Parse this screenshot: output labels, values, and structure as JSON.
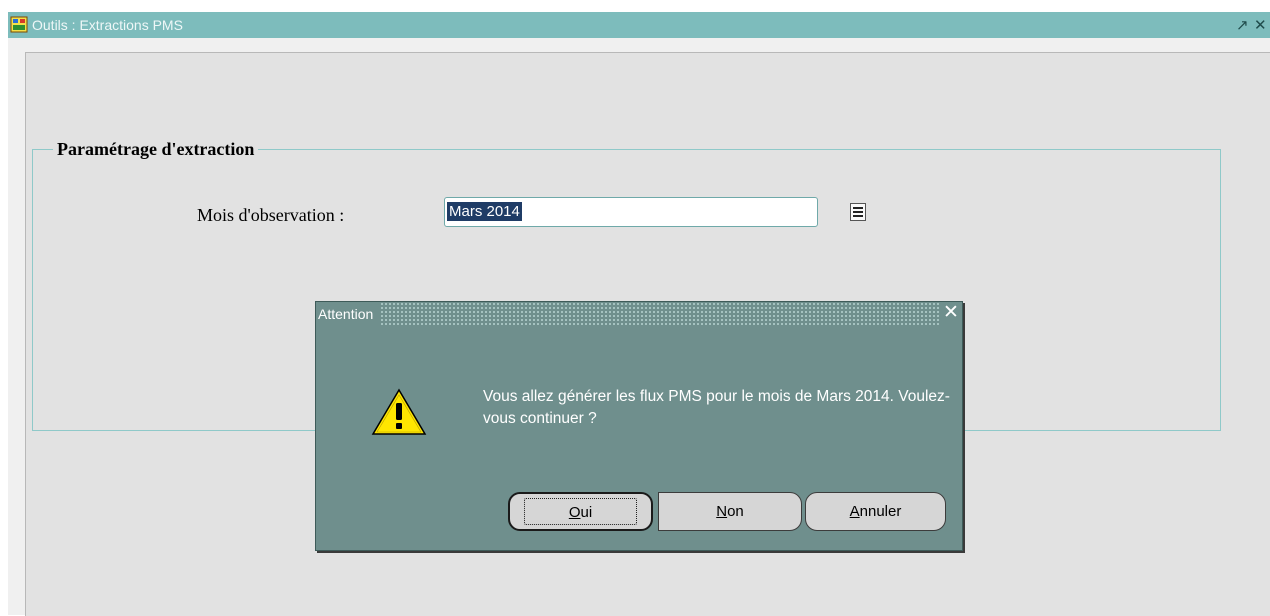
{
  "window": {
    "title": "Outils : Extractions PMS",
    "minimize_glyph": "↗",
    "close_glyph": "✕"
  },
  "form": {
    "frame_title": "Paramétrage d'extraction",
    "month_label": "Mois d'observation :",
    "month_value": "Mars 2014",
    "list_button_icon": "list-icon"
  },
  "dialog": {
    "title": "Attention",
    "close_glyph": "✕",
    "icon": "warning-icon",
    "message": "Vous allez générer les flux PMS pour le mois de Mars 2014. Voulez-vous continuer ?",
    "buttons": {
      "yes_mnemonic": "O",
      "yes_rest": "ui",
      "no_mnemonic": "N",
      "no_rest": "on",
      "cancel_mnemonic": "A",
      "cancel_rest": "nnuler"
    }
  },
  "colors": {
    "titlebar": "#7dbcbc",
    "dialog_bg": "#6f8f8d",
    "canvas_bg": "#e2e2e2",
    "selection": "#1f3c66",
    "warning": "#ffe600"
  }
}
